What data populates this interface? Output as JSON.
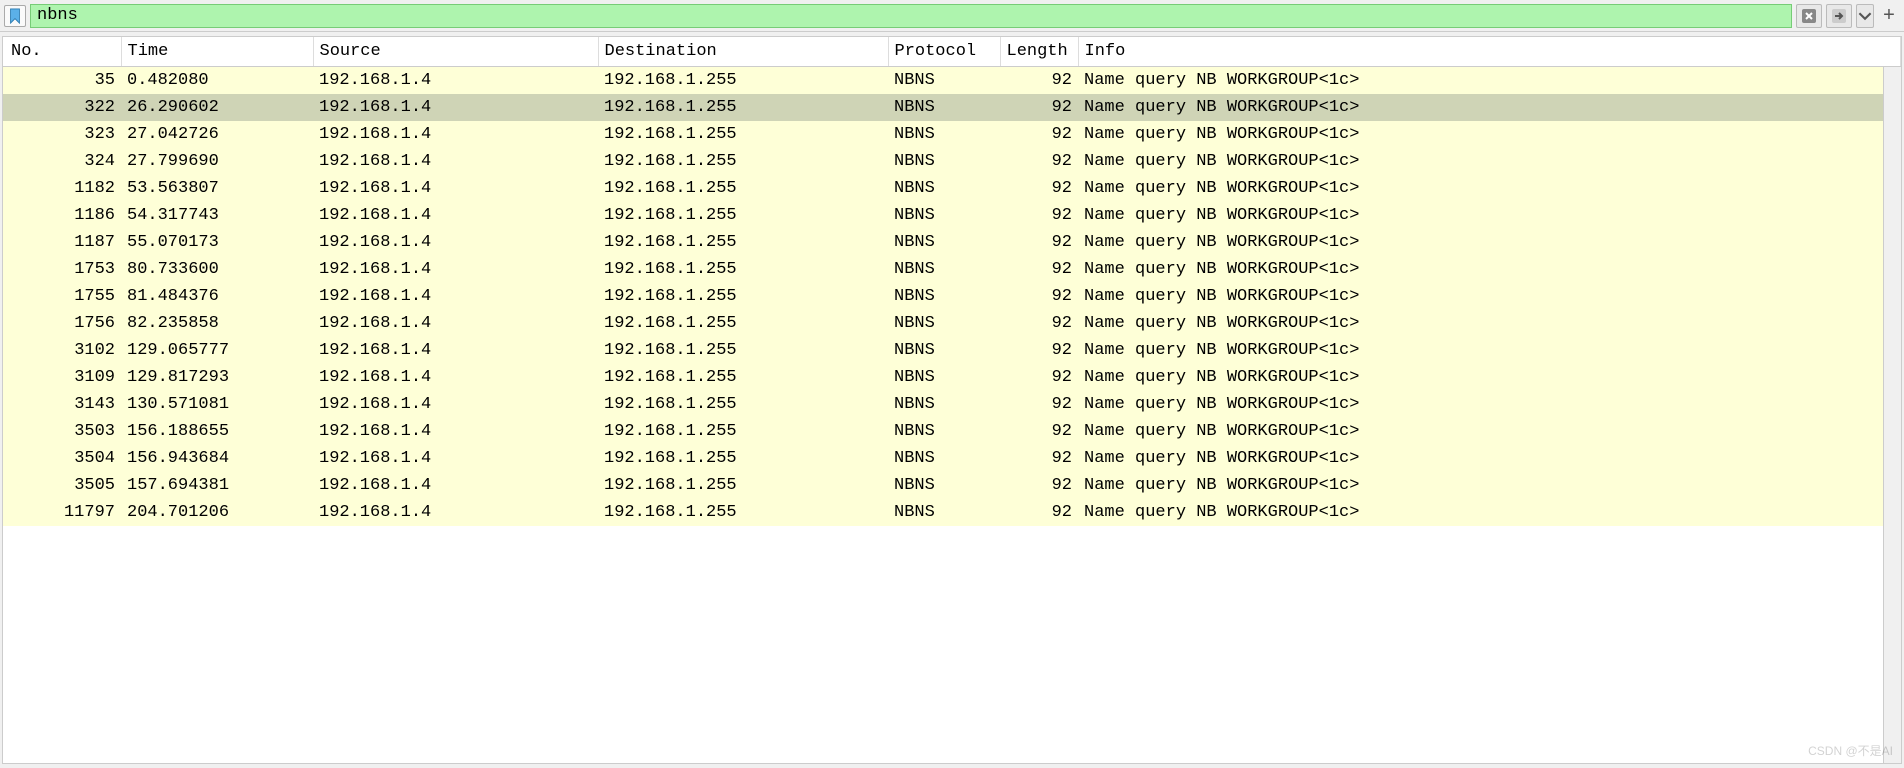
{
  "filter": {
    "value": "nbns",
    "clear_tooltip": "Clear",
    "apply_tooltip": "Apply",
    "history_tooltip": "History",
    "add_tooltip": "Add filter"
  },
  "columns": {
    "no": "No.",
    "time": "Time",
    "source": "Source",
    "destination": "Destination",
    "protocol": "Protocol",
    "length": "Length",
    "info": "Info"
  },
  "packets": [
    {
      "no": 35,
      "time": "0.482080",
      "src": "192.168.1.4",
      "dst": "192.168.1.255",
      "proto": "NBNS",
      "len": 92,
      "info": "Name query NB WORKGROUP<1c>",
      "selected": false,
      "marker": true
    },
    {
      "no": 322,
      "time": "26.290602",
      "src": "192.168.1.4",
      "dst": "192.168.1.255",
      "proto": "NBNS",
      "len": 92,
      "info": "Name query NB WORKGROUP<1c>",
      "selected": true
    },
    {
      "no": 323,
      "time": "27.042726",
      "src": "192.168.1.4",
      "dst": "192.168.1.255",
      "proto": "NBNS",
      "len": 92,
      "info": "Name query NB WORKGROUP<1c>",
      "selected": false
    },
    {
      "no": 324,
      "time": "27.799690",
      "src": "192.168.1.4",
      "dst": "192.168.1.255",
      "proto": "NBNS",
      "len": 92,
      "info": "Name query NB WORKGROUP<1c>",
      "selected": false
    },
    {
      "no": 1182,
      "time": "53.563807",
      "src": "192.168.1.4",
      "dst": "192.168.1.255",
      "proto": "NBNS",
      "len": 92,
      "info": "Name query NB WORKGROUP<1c>",
      "selected": false
    },
    {
      "no": 1186,
      "time": "54.317743",
      "src": "192.168.1.4",
      "dst": "192.168.1.255",
      "proto": "NBNS",
      "len": 92,
      "info": "Name query NB WORKGROUP<1c>",
      "selected": false
    },
    {
      "no": 1187,
      "time": "55.070173",
      "src": "192.168.1.4",
      "dst": "192.168.1.255",
      "proto": "NBNS",
      "len": 92,
      "info": "Name query NB WORKGROUP<1c>",
      "selected": false
    },
    {
      "no": 1753,
      "time": "80.733600",
      "src": "192.168.1.4",
      "dst": "192.168.1.255",
      "proto": "NBNS",
      "len": 92,
      "info": "Name query NB WORKGROUP<1c>",
      "selected": false
    },
    {
      "no": 1755,
      "time": "81.484376",
      "src": "192.168.1.4",
      "dst": "192.168.1.255",
      "proto": "NBNS",
      "len": 92,
      "info": "Name query NB WORKGROUP<1c>",
      "selected": false
    },
    {
      "no": 1756,
      "time": "82.235858",
      "src": "192.168.1.4",
      "dst": "192.168.1.255",
      "proto": "NBNS",
      "len": 92,
      "info": "Name query NB WORKGROUP<1c>",
      "selected": false
    },
    {
      "no": 3102,
      "time": "129.065777",
      "src": "192.168.1.4",
      "dst": "192.168.1.255",
      "proto": "NBNS",
      "len": 92,
      "info": "Name query NB WORKGROUP<1c>",
      "selected": false
    },
    {
      "no": 3109,
      "time": "129.817293",
      "src": "192.168.1.4",
      "dst": "192.168.1.255",
      "proto": "NBNS",
      "len": 92,
      "info": "Name query NB WORKGROUP<1c>",
      "selected": false
    },
    {
      "no": 3143,
      "time": "130.571081",
      "src": "192.168.1.4",
      "dst": "192.168.1.255",
      "proto": "NBNS",
      "len": 92,
      "info": "Name query NB WORKGROUP<1c>",
      "selected": false
    },
    {
      "no": 3503,
      "time": "156.188655",
      "src": "192.168.1.4",
      "dst": "192.168.1.255",
      "proto": "NBNS",
      "len": 92,
      "info": "Name query NB WORKGROUP<1c>",
      "selected": false
    },
    {
      "no": 3504,
      "time": "156.943684",
      "src": "192.168.1.4",
      "dst": "192.168.1.255",
      "proto": "NBNS",
      "len": 92,
      "info": "Name query NB WORKGROUP<1c>",
      "selected": false
    },
    {
      "no": 3505,
      "time": "157.694381",
      "src": "192.168.1.4",
      "dst": "192.168.1.255",
      "proto": "NBNS",
      "len": 92,
      "info": "Name query NB WORKGROUP<1c>",
      "selected": false
    },
    {
      "no": 11797,
      "time": "204.701206",
      "src": "192.168.1.4",
      "dst": "192.168.1.255",
      "proto": "NBNS",
      "len": 92,
      "info": "Name query NB WORKGROUP<1c>",
      "selected": false
    }
  ],
  "watermark": "CSDN @不是AI"
}
